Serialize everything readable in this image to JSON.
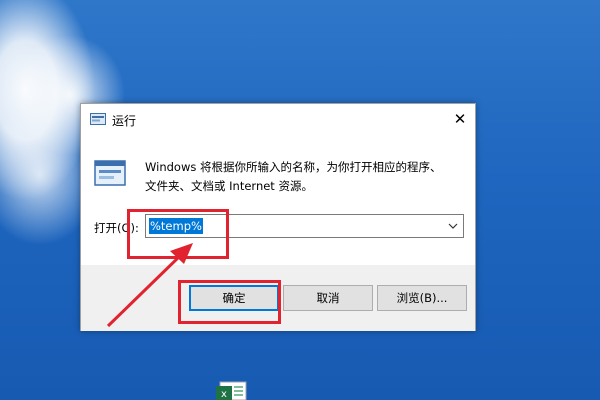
{
  "dialog": {
    "title": "运行",
    "close_glyph": "✕",
    "description_line1": "Windows 将根据你所输入的名称，为你打开相应的程序、",
    "description_line2": "文件夹、文档或 Internet 资源。",
    "open_label": "打开(O):",
    "open_value": "%temp%",
    "buttons": {
      "ok": "确定",
      "cancel": "取消",
      "browse": "浏览(B)..."
    }
  },
  "icons": {
    "title": "run-icon",
    "body": "run-icon",
    "combo_dropdown": "chevron-down-icon",
    "close": "close-icon",
    "desktop_file": "excel-file-icon"
  },
  "colors": {
    "annotation": "#e0232e",
    "selection": "#0078d7",
    "default_button_border": "#0078d7",
    "desktop_blue": "#1e66bf"
  }
}
